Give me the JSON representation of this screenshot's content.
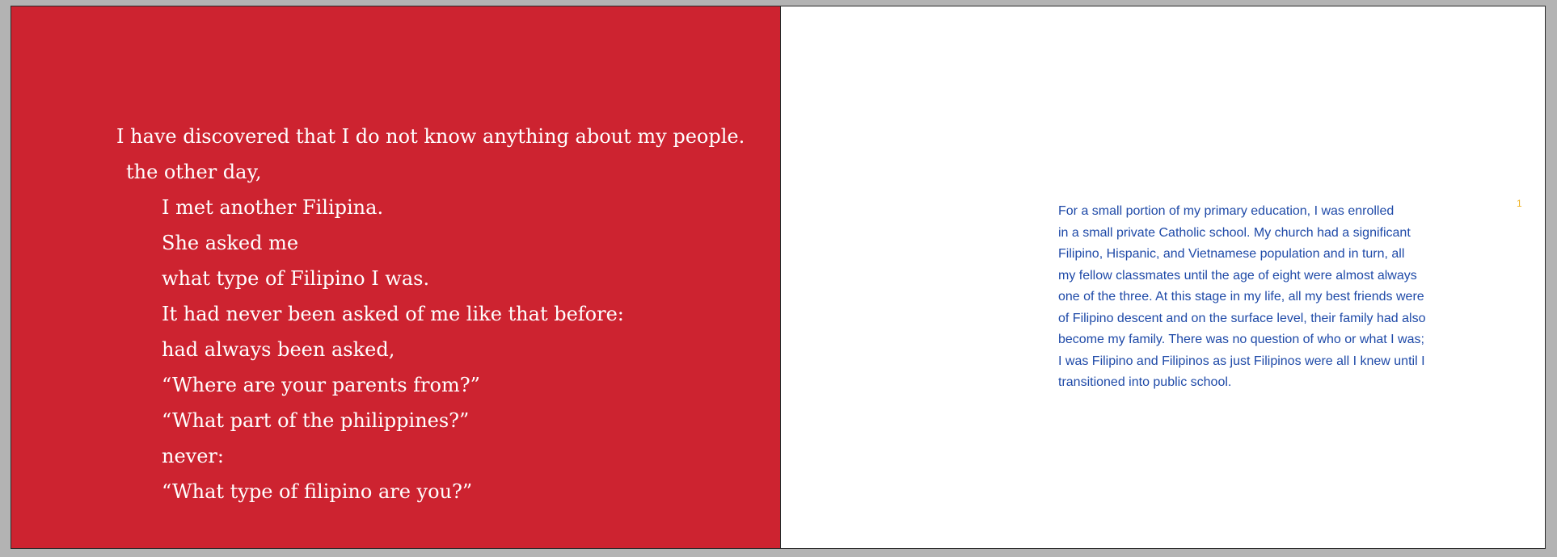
{
  "left_page": {
    "background": "#cd2330",
    "text_color": "#ffffff",
    "lines": [
      "I have discovered that I do not know anything about my people.",
      "the other day,",
      "I met another Filipina.",
      "She asked me",
      "what type of Filipino I was.",
      "It had never been asked of me like that before:",
      "had always been asked,",
      "“Where are your parents from?”",
      "“What part of the philippines?”",
      "never:",
      "“What type of filipino are you?”"
    ]
  },
  "right_page": {
    "text_color": "#1f4aa8",
    "page_number": "1",
    "page_number_color": "#f0b323",
    "paragraph_lines": [
      "For a small portion of my primary education, I was enrolled",
      "in a small private Catholic school. My church had a significant",
      "Filipino, Hispanic, and Vietnamese population and in turn, all",
      "my fellow classmates until the age of eight were almost always",
      "one of the three. At this stage in my life, all my best friends were",
      "of Filipino descent and on the surface level, their family had also",
      "become my family. There was no question of who or what I was;",
      "I was Filipino and Filipinos as just Filipinos were all I knew until I",
      "transitioned into public school."
    ]
  }
}
